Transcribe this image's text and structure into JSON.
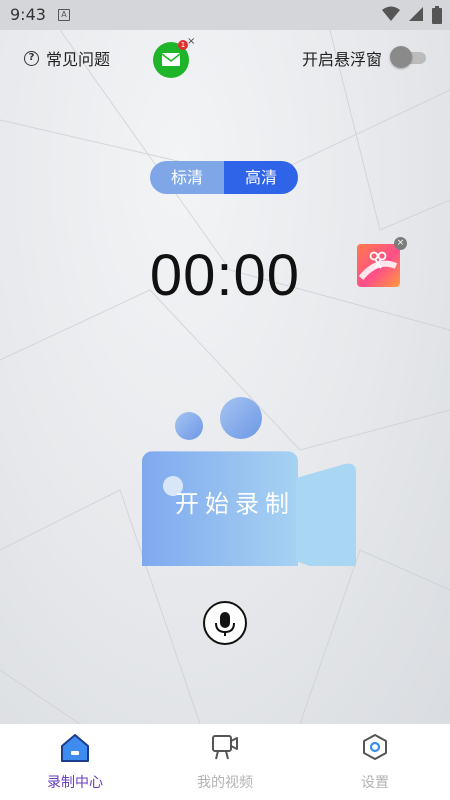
{
  "status_bar": {
    "time": "9:43",
    "notification_icon": "A",
    "icons": [
      "wifi-icon",
      "signal-icon",
      "battery-icon"
    ]
  },
  "header": {
    "faq_icon": "?",
    "faq_label": "常见问题",
    "mail_badge": "1",
    "mail_close": "×",
    "floating_window_label": "开启悬浮窗",
    "floating_window_enabled": false
  },
  "quality": {
    "options": [
      "标清",
      "高清"
    ],
    "selected": "高清"
  },
  "timer": "00:00",
  "edit_ad_close": "×",
  "record_button_label": "开始录制",
  "nav": {
    "items": [
      {
        "label": "录制中心",
        "icon": "home-icon",
        "active": true
      },
      {
        "label": "我的视频",
        "icon": "video-icon",
        "active": false
      },
      {
        "label": "设置",
        "icon": "settings-icon",
        "active": false
      }
    ]
  },
  "colors": {
    "accent": "#2f63e8",
    "accent_light": "#7fa7e8",
    "nav_active": "#6a3dc2",
    "mail_green": "#1fb52a"
  }
}
